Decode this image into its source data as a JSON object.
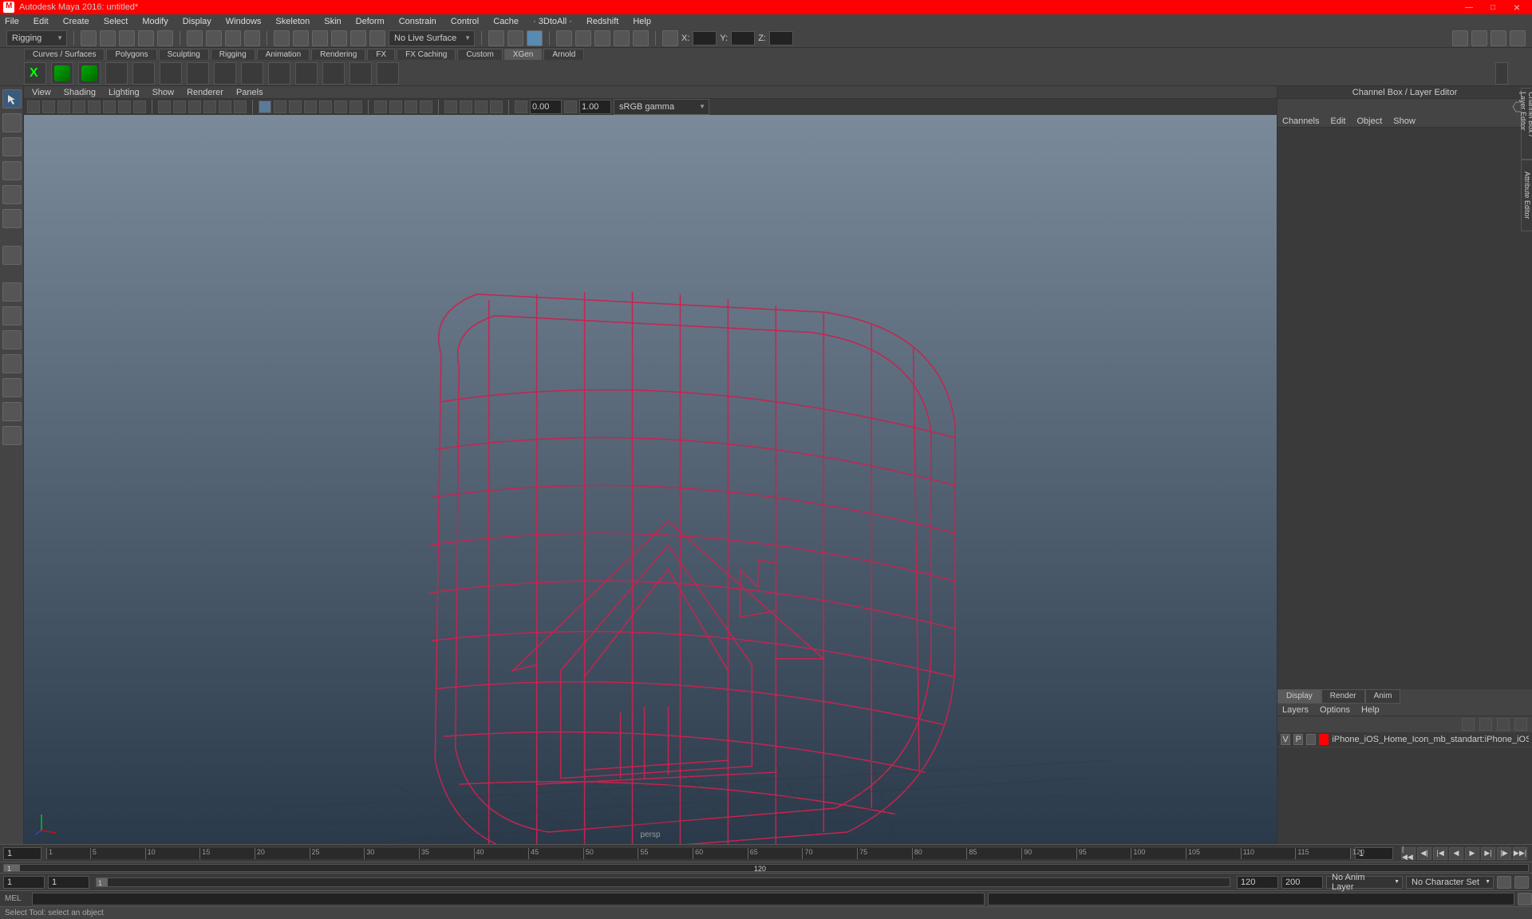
{
  "title": "Autodesk Maya 2016: untitled*",
  "menus": [
    "File",
    "Edit",
    "Create",
    "Select",
    "Modify",
    "Display",
    "Windows",
    "Skeleton",
    "Skin",
    "Deform",
    "Constrain",
    "Control",
    "Cache",
    "· 3DtoAll ·",
    "Redshift",
    "Help"
  ],
  "workspace_selector": "Rigging",
  "surface_label": "No Live Surface",
  "xyz": {
    "x": "X:",
    "y": "Y:",
    "z": "Z:"
  },
  "shelf_tabs": [
    "Curves / Surfaces",
    "Polygons",
    "Sculpting",
    "Rigging",
    "Animation",
    "Rendering",
    "FX",
    "FX Caching",
    "Custom",
    "XGen",
    "Arnold"
  ],
  "active_shelf": "XGen",
  "vp_menus": [
    "View",
    "Shading",
    "Lighting",
    "Show",
    "Renderer",
    "Panels"
  ],
  "vp_gamma": "sRGB gamma",
  "vp_val1": "0.00",
  "vp_val2": "1.00",
  "persp": "persp",
  "channel_box_title": "Channel Box / Layer Editor",
  "cb_menus": [
    "Channels",
    "Edit",
    "Object",
    "Show"
  ],
  "right_tabs": [
    "Channel Box / Layer Editor",
    "Attribute Editor"
  ],
  "layer_tabs": [
    "Display",
    "Render",
    "Anim"
  ],
  "layer_menus": [
    "Layers",
    "Options",
    "Help"
  ],
  "layer": {
    "v": "V",
    "p": "P",
    "name": "iPhone_iOS_Home_Icon_mb_standart:iPhone_iOS_Home_"
  },
  "timeline": {
    "ticks": [
      1,
      5,
      10,
      15,
      20,
      25,
      30,
      35,
      40,
      45,
      50,
      55,
      60,
      65,
      70,
      75,
      80,
      85,
      90,
      95,
      100,
      105,
      110,
      115,
      120
    ],
    "cur_start": "1",
    "cur_end": "1",
    "start": "1",
    "end": "1",
    "range_start": "1",
    "range_end": "120",
    "total_end": "120",
    "total_end2": "200"
  },
  "anim_layer": "No Anim Layer",
  "char_set": "No Character Set",
  "cmd_label": "MEL",
  "status": "Select Tool: select an object"
}
